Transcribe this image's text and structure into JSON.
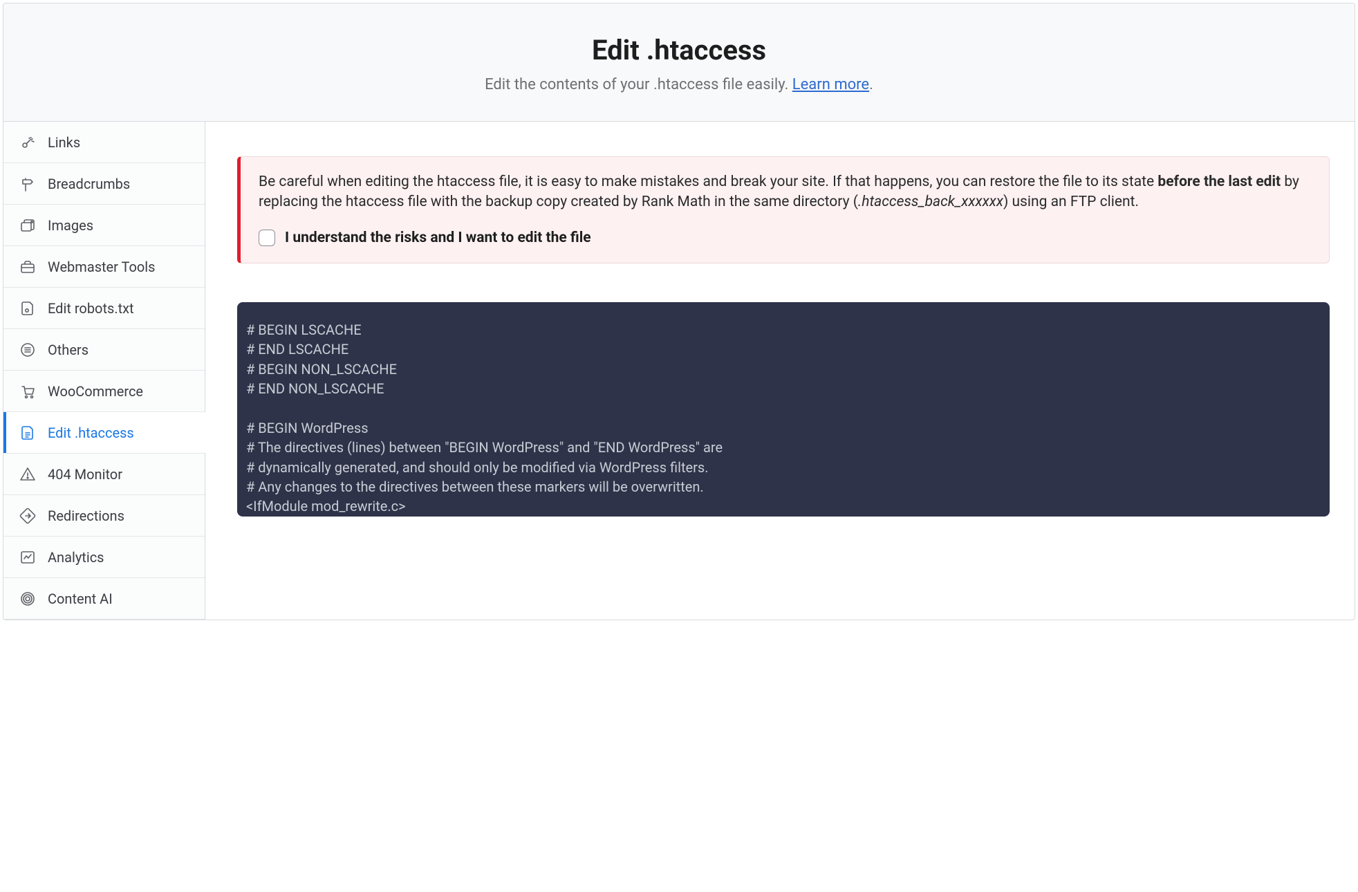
{
  "header": {
    "title": "Edit .htaccess",
    "subtitle_pre": "Edit the contents of your .htaccess file easily. ",
    "learn_more": "Learn more",
    "subtitle_post": "."
  },
  "sidebar": {
    "items": [
      {
        "id": "links",
        "label": "Links"
      },
      {
        "id": "breadcrumbs",
        "label": "Breadcrumbs"
      },
      {
        "id": "images",
        "label": "Images"
      },
      {
        "id": "webmaster",
        "label": "Webmaster Tools"
      },
      {
        "id": "robots",
        "label": "Edit robots.txt"
      },
      {
        "id": "others",
        "label": "Others"
      },
      {
        "id": "woocommerce",
        "label": "WooCommerce"
      },
      {
        "id": "htaccess",
        "label": "Edit .htaccess"
      },
      {
        "id": "404",
        "label": "404 Monitor"
      },
      {
        "id": "redirections",
        "label": "Redirections"
      },
      {
        "id": "analytics",
        "label": "Analytics"
      },
      {
        "id": "contentai",
        "label": "Content AI"
      }
    ],
    "active": "htaccess"
  },
  "alert": {
    "seg1": "Be careful when editing the htaccess file, it is easy to make mistakes and break your site. If that happens, you can restore the file to its state ",
    "bold": "before the last edit",
    "seg2": " by replacing the htaccess file with the backup copy created by Rank Math in the same directory (",
    "ital": ".htaccess_back_xxxxxx",
    "seg3": ") using an FTP client.",
    "consent_label": "I understand the risks and I want to edit the file",
    "consent_checked": false
  },
  "code": " # BEGIN LSCACHE\n # END LSCACHE\n # BEGIN NON_LSCACHE\n # END NON_LSCACHE\n\n # BEGIN WordPress\n # The directives (lines) between \"BEGIN WordPress\" and \"END WordPress\" are\n # dynamically generated, and should only be modified via WordPress filters.\n # Any changes to the directives between these markers will be overwritten.\n <IfModule mod_rewrite.c>\n RewriteEngine On"
}
